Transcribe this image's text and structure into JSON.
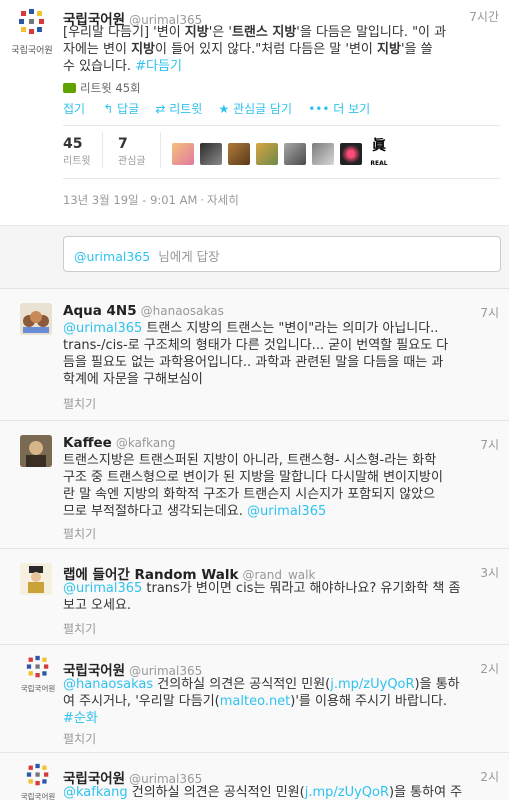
{
  "main_tweet": {
    "account_name": "국립국어원",
    "account_handle": "@urimal365",
    "account_logo_caption": "국립국어원",
    "time": "7시간",
    "text": {
      "line1_prefix": "[우리말 다듬기] '변이 ",
      "line1_bold1": "지방",
      "line1_mid": "'은 '",
      "line1_bold2": "트랜스 지방",
      "line1_suffix": "'을 다듬은 말입니다. \"이 과",
      "line2_prefix": "자에는 변이 ",
      "line2_bold1": "지방",
      "line2_mid": "이 들어 있지 않다.\"처럼 다듬은 말 '변이 ",
      "line2_bold2": "지방",
      "line2_suffix": "'을 쓸",
      "line3_text": "수 있습니다. ",
      "line3_hashtag": "#다듬기"
    },
    "retweet_count_label": "리트윗 45회",
    "actions": {
      "collapse": "접기",
      "reply": "답글",
      "retweet": "리트윗",
      "favorite": "관심글 담기",
      "more": "더 보기"
    },
    "stats": {
      "retweets_value": "45",
      "retweets_label": "리트윗",
      "favorites_value": "7",
      "favorites_label": "관심글"
    },
    "timestamp": "13년 3월 19일 - 9:01 AM",
    "details_link": "자세히",
    "avatar_count": 8,
    "last_avatar_text": "眞",
    "last_avatar_subtext": "REAL"
  },
  "reply_box": {
    "mention": "@urimal365",
    "placeholder_suffix": "님에게 답장"
  },
  "replies": [
    {
      "name": "Aqua 4N5",
      "handle": "@hanaosakas",
      "time": "7시",
      "lines": [
        {
          "mention": "@urimal365",
          "text": " 트랜스 지방의 트랜스는 \"변이\"라는 의미가 아닙니다.."
        },
        {
          "mention": "",
          "text": "trans-/cis-로 구조체의 형태가 다른 것입니다... 굳이 번역할 필요도 다"
        },
        {
          "mention": "",
          "text": "듬을 필요도 없는 과학용어입니다.. 과학과 관련된 말을 다듬을 때는 과"
        },
        {
          "mention": "",
          "text": "학계에 자문을 구해보심이"
        }
      ],
      "expand": "펼치기"
    },
    {
      "name": "Kaffee",
      "handle": "@kafkang",
      "time": "7시",
      "lines": [
        {
          "mention": "",
          "text": "트랜스지방은 트랜스퍼된 지방이 아니라, 트랜스형- 시스형-라는 화학"
        },
        {
          "mention": "",
          "text": "구조 중 트랜스형으로 변이가 된 지방을 말합니다 다시말해 변이지방이"
        },
        {
          "mention": "",
          "text": "란 말 속엔 지방의 화학적 구조가 트랜슨지 시슨지가 포함되지 않았으"
        },
        {
          "mention": "",
          "text": "므로 부적절하다고 생각되는데요. ",
          "trailing_mention": "@urimal365"
        }
      ],
      "expand": "펼치기"
    },
    {
      "name": "랩에 들어간 Random Walk",
      "handle": "@rand_walk",
      "time": "3시",
      "lines": [
        {
          "mention": "@urimal365",
          "text": " trans가 변이면 cis는 뭐라고 해야하나요? 유기화학 책 좀"
        },
        {
          "mention": "",
          "text": "보고 오세요."
        }
      ],
      "expand": "펼치기"
    },
    {
      "name": "국립국어원",
      "handle": "@urimal365",
      "time": "2시",
      "logo_caption": "국립국어원",
      "lines": [
        {
          "mention": "@hanaosakas",
          "text": " 건의하실 의견은 공식적인 민원(",
          "link": "j.mp/zUyQoR",
          "after": ")을 통하"
        },
        {
          "mention": "",
          "text": "여 주시거나, '우리말 다듬기(",
          "link": "malteo.net",
          "after": ")'를 이용해 주시기 바랍니다."
        },
        {
          "mention": "",
          "text": "",
          "hashtag": "#순화"
        }
      ],
      "expand": "펼치기"
    },
    {
      "name": "국립국어원",
      "handle": "@urimal365",
      "time": "2시",
      "logo_caption": "국립국어원",
      "lines": [
        {
          "mention": "@kafkang",
          "text": " 건의하실 의견은 공식적인 민원(",
          "link": "j.mp/zUyQoR",
          "after": ")을 통하여 주"
        }
      ]
    }
  ],
  "colors": {
    "link": "#2fc2ef",
    "muted": "#999999",
    "text": "#333333",
    "logo_red": "#d63a3a",
    "logo_blue": "#2b57a8",
    "logo_yellow": "#f2c230",
    "logo_gray": "#777777"
  }
}
